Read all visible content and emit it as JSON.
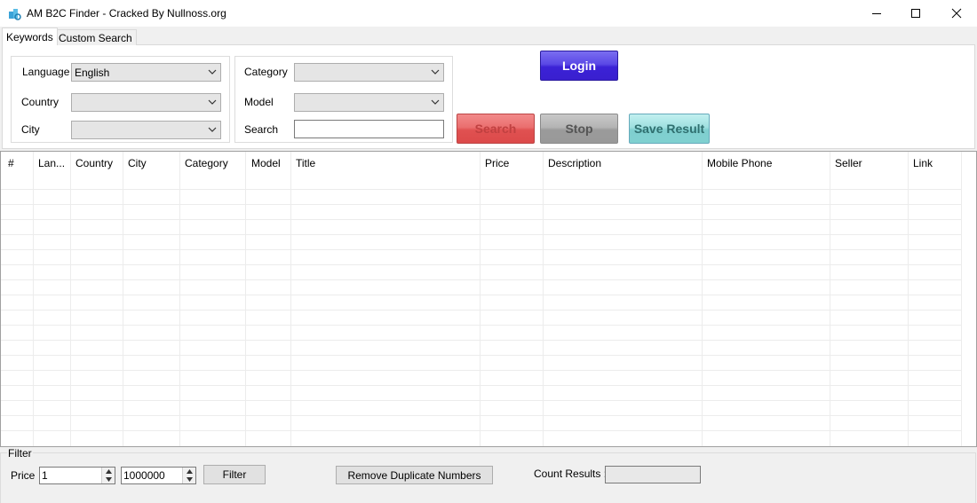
{
  "window": {
    "title": "AM B2C Finder - Cracked By Nullnoss.org"
  },
  "tabs": [
    {
      "label": "Keywords",
      "selected": true
    },
    {
      "label": "Custom Search",
      "selected": false
    }
  ],
  "filters_left": {
    "language_label": "Language",
    "language_value": "English",
    "country_label": "Country",
    "country_value": "",
    "city_label": "City",
    "city_value": ""
  },
  "filters_right": {
    "category_label": "Category",
    "category_value": "",
    "model_label": "Model",
    "model_value": "",
    "search_label": "Search",
    "search_value": ""
  },
  "buttons": {
    "login": "Login",
    "search": "Search",
    "stop": "Stop",
    "save_result": "Save Result"
  },
  "grid": {
    "columns": [
      "#",
      "Lan...",
      "Country",
      "City",
      "Category",
      "Model",
      "Title",
      "Price",
      "Description",
      "Mobile Phone",
      "Seller",
      "Link"
    ],
    "rows": []
  },
  "filter": {
    "group_label": "Filter",
    "price_label": "Price",
    "price_min": "1",
    "price_max": "1000000",
    "filter_button": "Filter",
    "remove_duplicates_button": "Remove Duplicate Numbers",
    "count_label": "Count Results :",
    "count_value": ""
  },
  "colors": {
    "login": "#3b22d6",
    "search": "#e05151",
    "stop": "#9a9a9a",
    "save_result": "#7fcfcf"
  }
}
